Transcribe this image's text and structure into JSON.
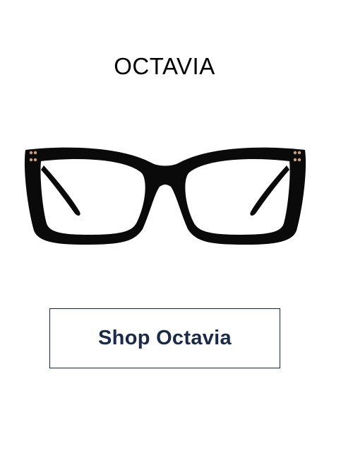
{
  "product": {
    "title": "OCTAVIA",
    "image_icon": "eyeglasses-icon",
    "frame_color": "#0a0a0a",
    "rivet_color": "#c9a27a"
  },
  "cta": {
    "label": "Shop Octavia",
    "text_color": "#1b2a47",
    "border_color": "#1a2438"
  }
}
